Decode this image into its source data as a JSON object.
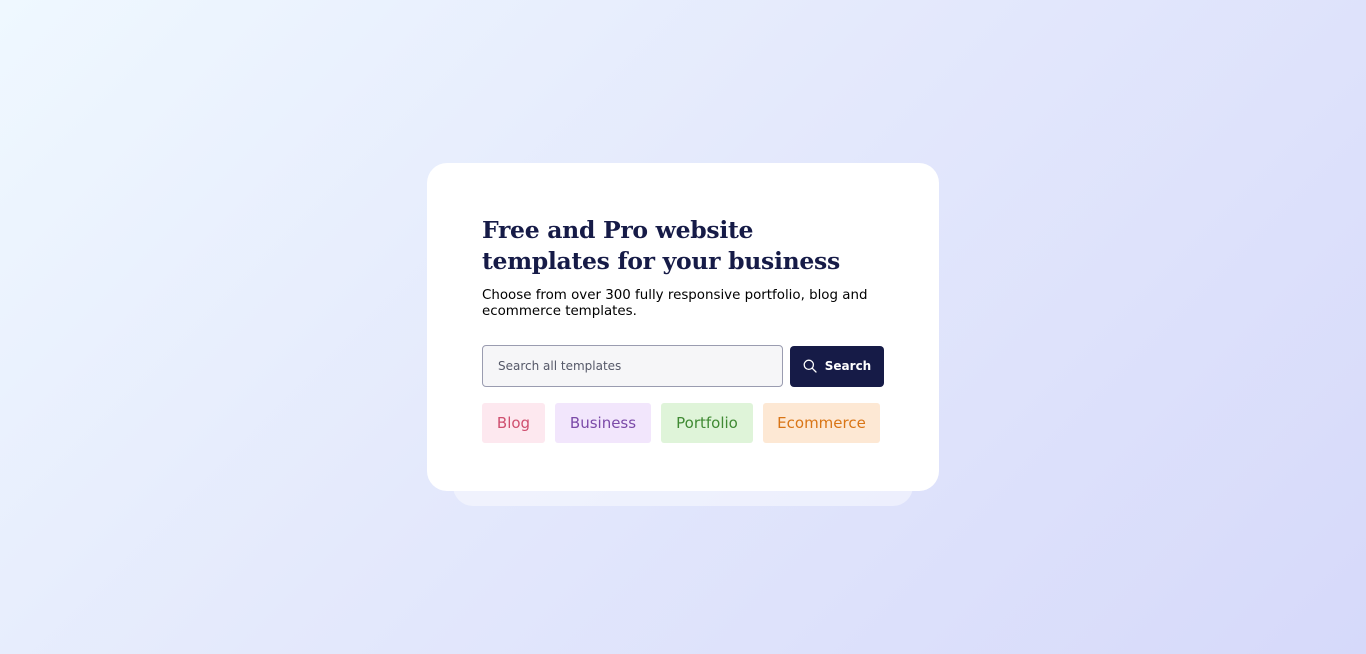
{
  "hero": {
    "title": "Free and Pro website templates for your business",
    "subtitle": "Choose from over 300 fully responsive portfolio, blog and ecommerce templates."
  },
  "search": {
    "placeholder": "Search all templates",
    "value": "",
    "button_label": "Search",
    "button_icon": "search-icon"
  },
  "tags": [
    {
      "label": "Blog",
      "color": "#cf4f6f",
      "background": "#fde8ef"
    },
    {
      "label": "Business",
      "color": "#7b4aa8",
      "background": "#f2e6fc"
    },
    {
      "label": "Portfolio",
      "color": "#3f8a33",
      "background": "#dff4d9"
    },
    {
      "label": "Ecommerce",
      "color": "#d97516",
      "background": "#fde8d4"
    }
  ],
  "colors": {
    "primary": "#161b47",
    "card": "#ffffff",
    "background_start": "#eff8ff",
    "background_end": "#d6d9fa"
  }
}
